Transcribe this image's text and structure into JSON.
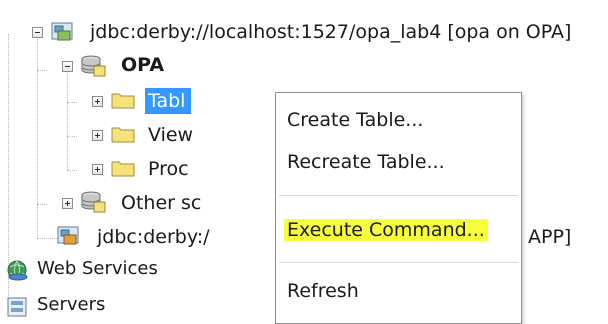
{
  "tree": {
    "connection_1": "jdbc:derby://localhost:1527/opa_lab4 [opa on OPA]",
    "schema": "OPA",
    "tables_folder": "Tabl",
    "views_folder": "View",
    "procedures_folder": "Proc",
    "other_schemas": "Other sc",
    "connection_2_start": "jdbc:derby:/",
    "connection_2_end": "APP]",
    "web_services": "Web Services",
    "servers": "Servers"
  },
  "context_menu": {
    "items": [
      {
        "label": "Create Table..."
      },
      {
        "label": "Recreate Table..."
      },
      {
        "label": "Execute Command..."
      },
      {
        "label": "Refresh"
      }
    ],
    "highlight_color": "#f6ff3c"
  },
  "colors": {
    "selection": "#3399ff",
    "folder": "#f4e27a",
    "db_blue": "#3d74a8"
  },
  "icons": {
    "connection": "db-connection-icon",
    "schema": "database-icon",
    "folder": "folder-icon",
    "web_services": "globe-icon",
    "servers": "servers-icon"
  }
}
